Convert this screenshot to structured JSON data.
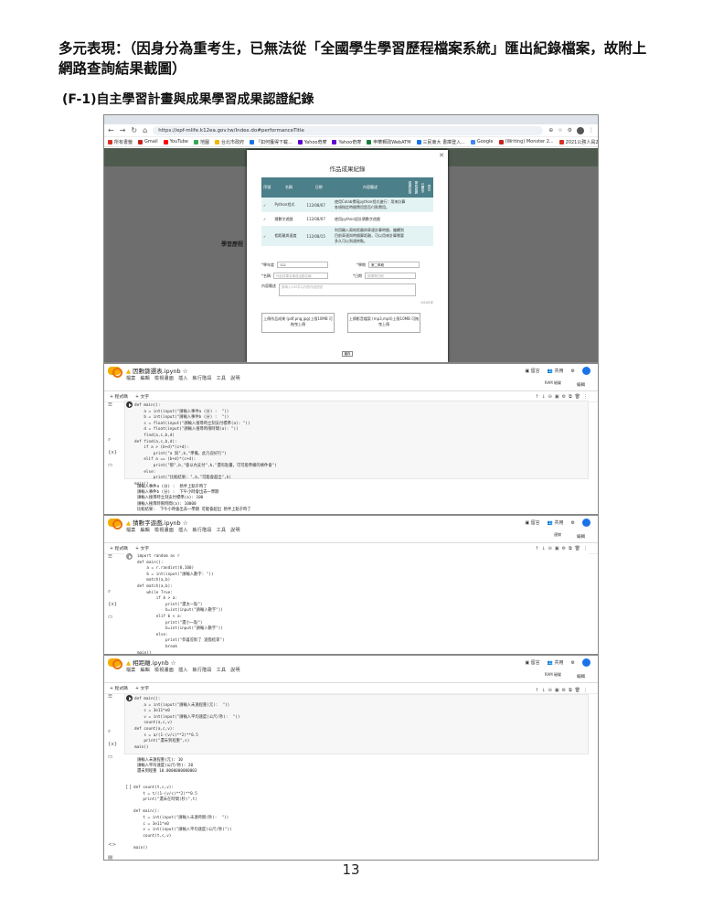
{
  "heading": {
    "main": "多元表現：",
    "sub": "（因身分為重考生，已無法從「全國學生學習歷程檔案系統」匯出紀錄檔案，故附上網路查詢結果截圖）"
  },
  "subheading": "(F-1)自主學習計畫與成果學習成果認證紀錄",
  "page_number": "13",
  "browser": {
    "url": "https://epf-mlife.k12ea.gov.tw/Index.do#performanceTitle",
    "bookmarks": [
      "所有書籤",
      "Gmail",
      "YouTube",
      "地圖",
      "台北市政府",
      "「如何獲得下載...",
      "Yahoo奇摩",
      "Yahoo奇摩",
      "申華郵政WebATM",
      "三民東大 書庫登入...",
      "Google",
      "(Writing) Monster 2...",
      "2021公務人員2000...",
      "所有書籤"
    ],
    "modal_title": "作品成果紀錄",
    "table_headers": [
      "序號",
      "名稱",
      "日期",
      "內容簡述",
      "認證狀態",
      "學校認證",
      "已開放",
      "提交"
    ],
    "rows": [
      {
        "name": "Python程式",
        "date": "112/08/07",
        "desc": "使用Colab撰寫python程式進行：用來計算各項指定時間費用是否付款費用。"
      },
      {
        "name": "猜數字遊戲",
        "date": "112/08/07",
        "desc": "使用python設計猜數字遊戲"
      },
      {
        "name": "相距離與速度",
        "date": "112/08/15",
        "desc": "利用輸入兩地距離與車速計算時間，繼續到目前車速與時間算距離，可以用來計算需要多久可以到達終點。"
      }
    ],
    "form": {
      "label_a": "*學年度",
      "value_a": "112",
      "label_b": "*學期",
      "value_b": "第二學期",
      "label_c": "*名稱",
      "ph_c": "作品成果名稱或活動名稱",
      "label_d": "*日期",
      "ph_d": "請選擇日期",
      "label_e": "內容簡述",
      "ph_e": "請填入100字以內的作品簡述",
      "counter": "0/100字",
      "upload1": "上傳作品成果 (pdf,png,jpg)上限10MB 可拖曳上傳",
      "upload2": "上傳影音檔案 (mp3,mp4)上限10MB 可拖曳上傳",
      "save": "儲存"
    },
    "bg_title": "學習歷程"
  },
  "colab1": {
    "title": "因數篩選表.ipynb",
    "menu": "檔案 編輯 檢視畫面 插入 執行階段 工具 說明",
    "toolbar": [
      "+ 程式碼",
      "+ 文字"
    ],
    "right": [
      "留言",
      "共用"
    ],
    "ram": "RAM 磁碟",
    "edit": "編輯",
    "code": "def main():\n    a = int(input(\"請輸入事件a (分) :  \"))\n    b = int(input(\"請輸入事件b (分) :  \"))\n    c = float(input(\"請輸入搜尋時立刻支付標準(a): \"))\n    d = float(input(\"請輸入搜尋時限時間(a): \"))\n    find(a,c,b,d)\ndef find(a,c,b,d):\n    if a > (b+d)*(c+d):\n        print(\"a 與\",b,\"準備，此乃良好行\")\n    elif a == (b+d)*(c+d):\n        print(\"那\",b,\"會以內支付\",b,\"還有點量，可可能準備的條件會\")\n    else:\n        print(\"比較結果: \",b,\"可能會超出\",b)\nmain()",
    "output": "請輸入事件a (分) :  熱手上點于時了\n請輸入事件b (分) :  下午小時會出去一學期\n請輸入搜尋時立刻支付標準(a): 100\n請輸入搜尋時限時間(a): 10000\n比較結果:  下午小時會出去一學期 可能會超出 熱手上點于時了"
  },
  "colab2": {
    "title": "猜數字遊戲.ipynb",
    "menu": "檔案 編輯 檢視畫面 插入 執行階段 工具 說明",
    "toolbar": [
      "+ 程式碼",
      "+ 文字"
    ],
    "right": [
      "留言",
      "共用"
    ],
    "ram": "連線",
    "edit": "編輯",
    "code": "import random as r\ndef main():\n    a = r.randint(0,100)\n    b = int(input(\"請輸入數字: \"))\n    match(a,b)\ndef match(a,b):\n    while True:\n        if b > a:\n            print(\"還太一點\")\n            b=int(input(\"請輸入數字\"))\n        elif b < a:\n            print(\"還小一點\")\n            b=int(input(\"請輸入數字\"))\n        else:\n            print(\"恭喜答對了 遊戲結束\")\n            break\nmain()"
  },
  "colab3": {
    "title": "相距離.ipynb",
    "menu": "檔案 編輯 檢視畫面 插入 執行階段 工具 說明",
    "toolbar": [
      "+ 程式碼",
      "+ 文字"
    ],
    "right": [
      "留言",
      "共用"
    ],
    "ram": "RAM 磁碟",
    "edit": "編輯",
    "code": "def main():\n    a = int(input(\"請輸入未遠程重(元):  \"))\n    c = 3e11*e0\n    v = int(input(\"請輸入平均速度(公尺/秒):  \"))\n    count(a,c,v)\ndef count(a,c,v):\n    s = a/(1-(v/c)**2)**0.5\n    print(\"還未到程重\",s)\nmain()",
    "output": "請輸入未遠程重(元): 10\n請輸入平均速度(公尺/秒): 20\n還未到程重 10.0000000000003",
    "code2": "def count(t,c,v):\n    t = t/(1-(v/c)**2)**0.5\n    print(\"還未在時間(秒)\",t)\n\ndef main():\n    t = int(input(\"請輸入未遠時間(秒):  \"))\n    c = 3e11*e0\n    v = int(input(\"請輸入平均速度(公尺/秒)\"))\n    count(t,c,v)\n\nmain()"
  }
}
